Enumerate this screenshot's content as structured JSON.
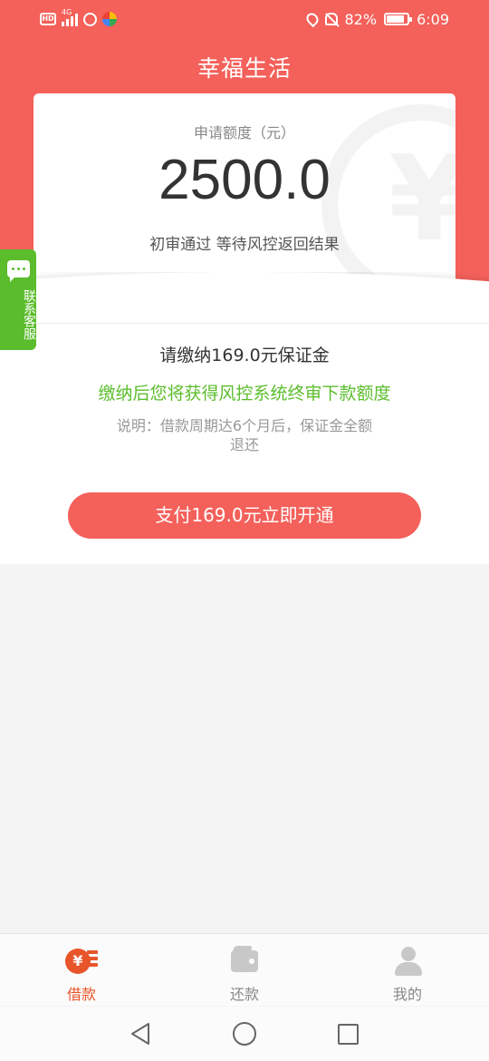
{
  "status_bar": {
    "battery": "82%",
    "time": "6:09",
    "network": "4G",
    "hd_label": "HD"
  },
  "header": {
    "title": "幸福生活"
  },
  "card": {
    "label": "申请额度（元）",
    "amount": "2500.0",
    "status": "初审通过 等待风控返回结果",
    "watermark_symbol": "¥"
  },
  "deposit": {
    "title": "请缴纳169.0元保证金",
    "description": "缴纳后您将获得风控系统终审下款额度",
    "note": "说明：借款周期达6个月后，保证金全额退还",
    "pay_button": "支付169.0元立即开通"
  },
  "service_tab": {
    "label": "联系客服",
    "icon": "chat-bubble-icon"
  },
  "tab_bar": {
    "tabs": [
      {
        "label": "借款",
        "icon": "loan-yen-icon",
        "active": true
      },
      {
        "label": "还款",
        "icon": "wallet-icon",
        "active": false
      },
      {
        "label": "我的",
        "icon": "user-icon",
        "active": false
      }
    ],
    "loan_icon_symbol": "¥"
  },
  "colors": {
    "brand_red": "#f4605a",
    "accent_green": "#5bbd2c",
    "active_tab": "#e8552a"
  }
}
